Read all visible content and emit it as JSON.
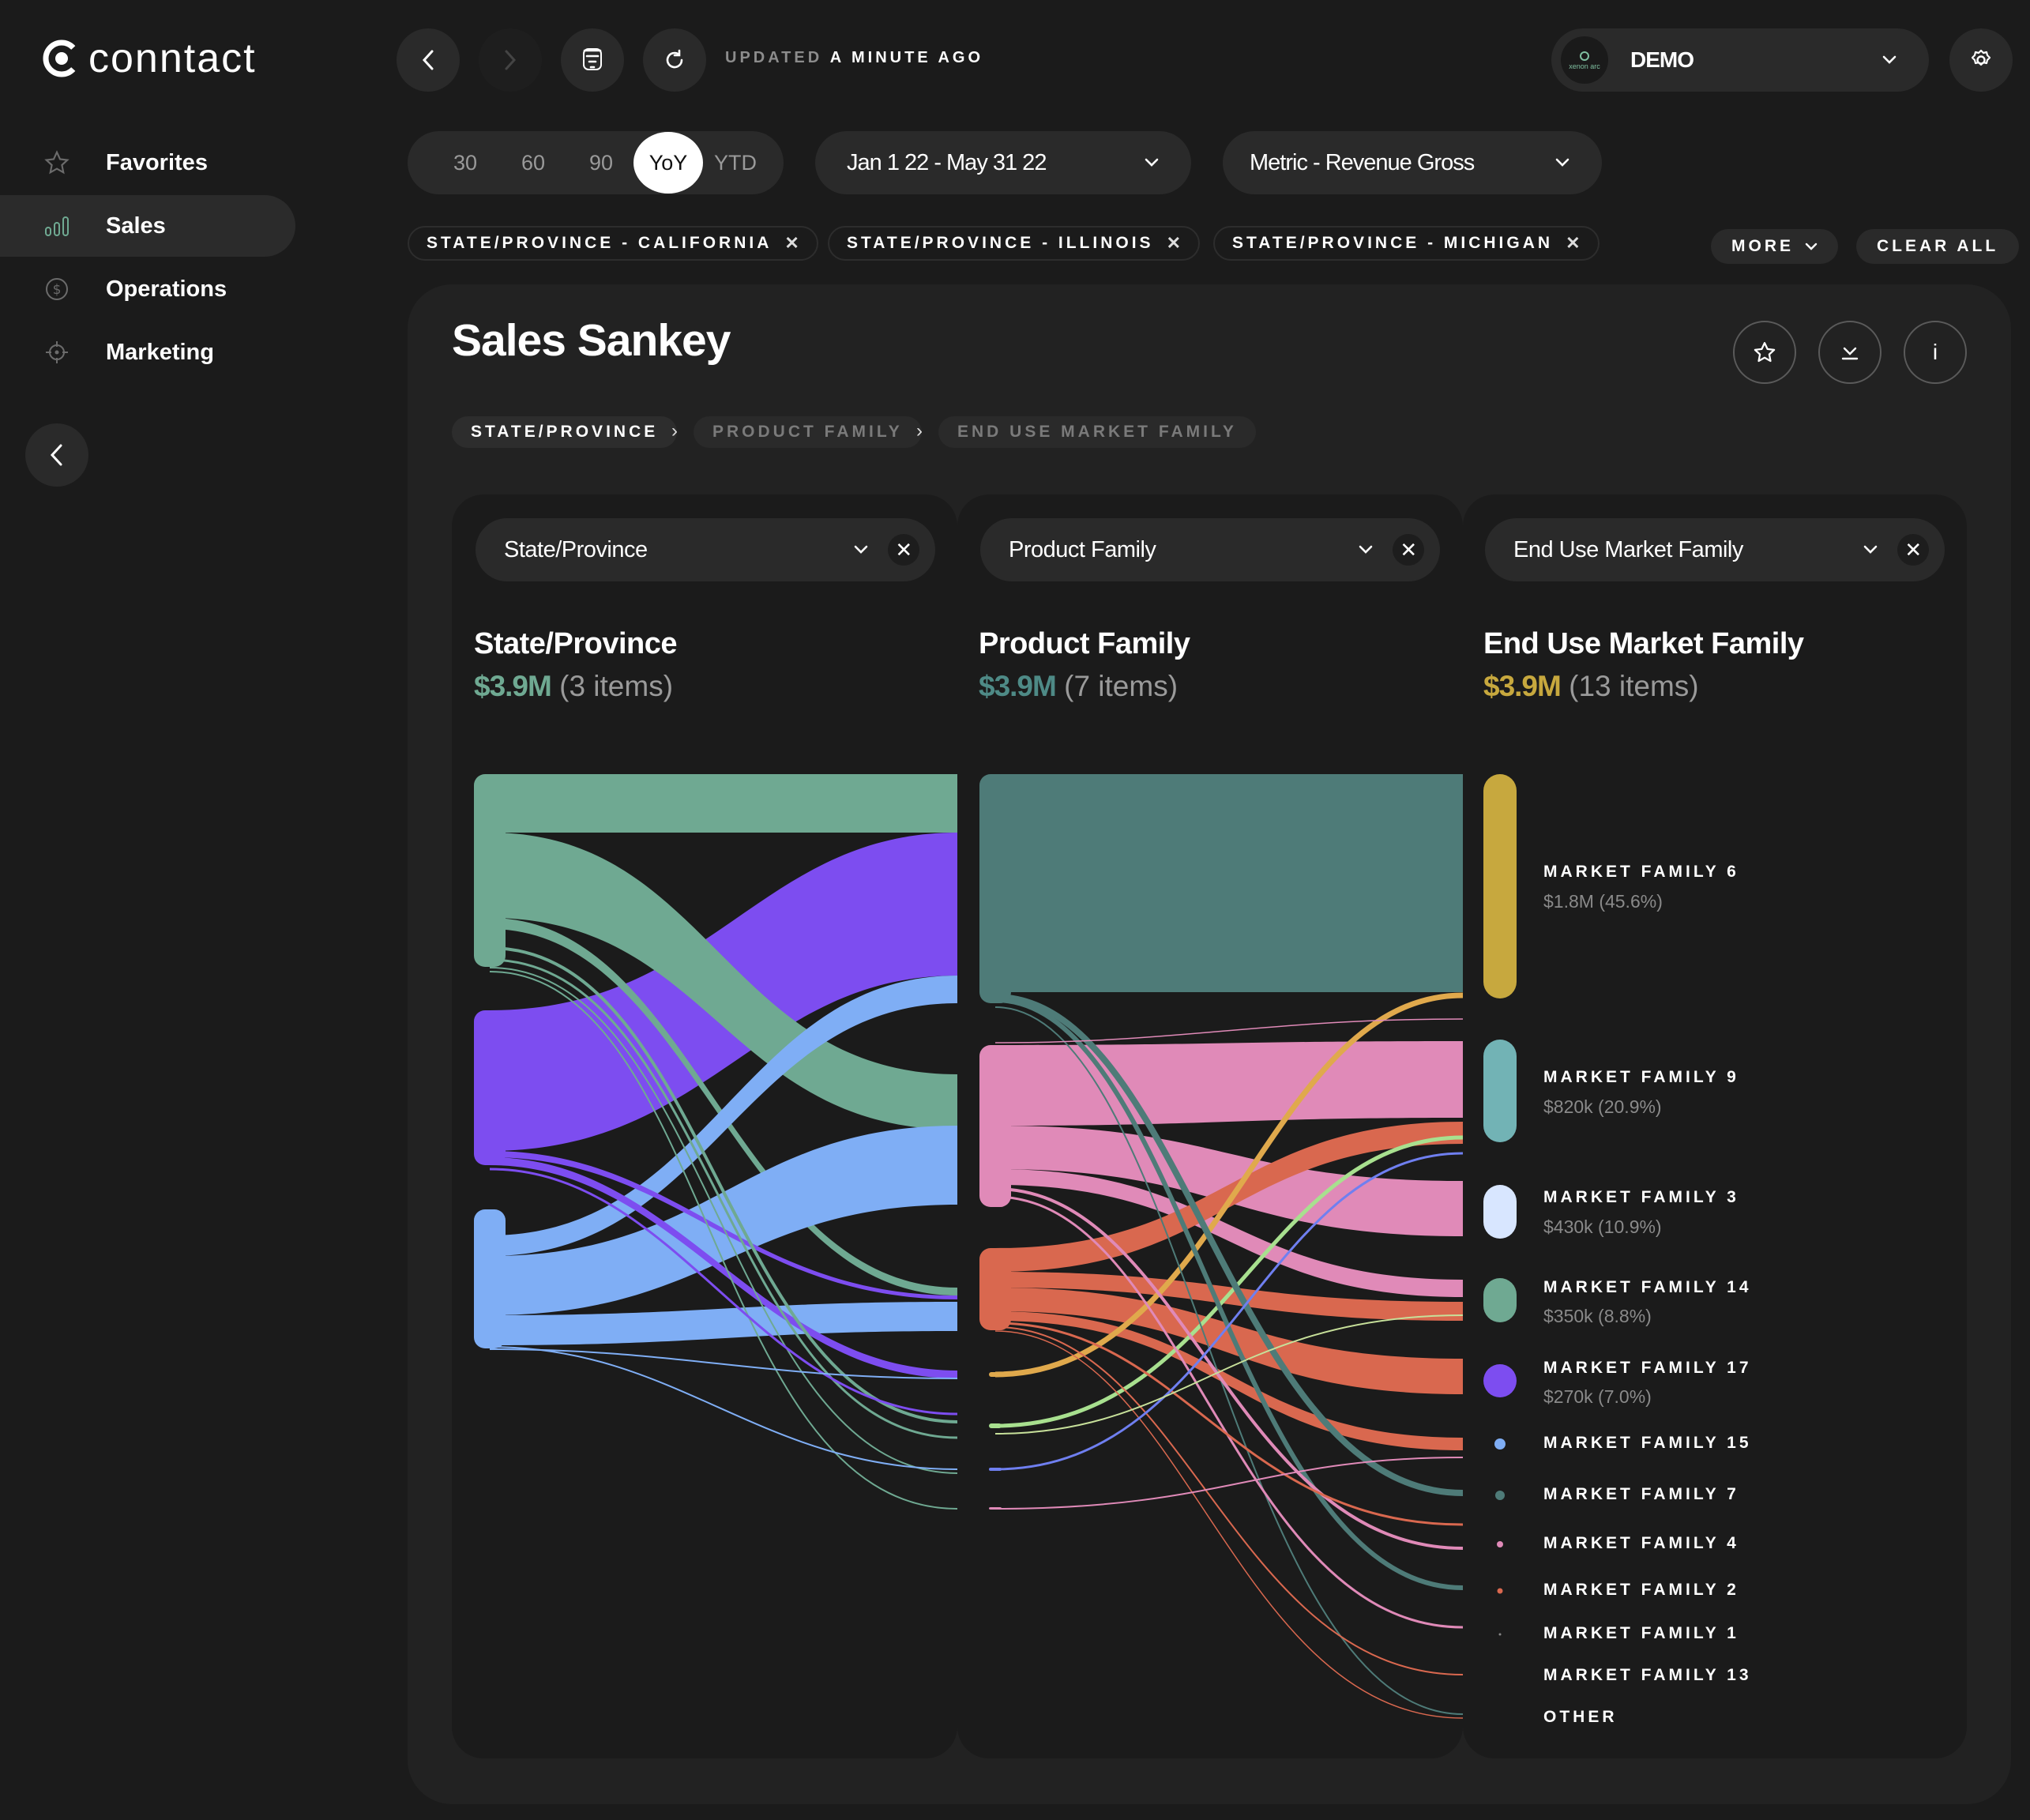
{
  "app": {
    "name": "conntact"
  },
  "sidebar": {
    "items": [
      {
        "label": "Favorites",
        "icon": "star-icon"
      },
      {
        "label": "Sales",
        "icon": "bar-chart-icon",
        "active": true
      },
      {
        "label": "Operations",
        "icon": "dollar-icon"
      },
      {
        "label": "Marketing",
        "icon": "target-icon"
      }
    ]
  },
  "topbar": {
    "updated_prefix": "UPDATED",
    "updated_time": "A MINUTE AGO",
    "workspace": {
      "avatar_text": "xenon arc",
      "name": "DEMO"
    }
  },
  "filters": {
    "periods": [
      "30",
      "60",
      "90",
      "YoY",
      "YTD"
    ],
    "selected_period": "YoY",
    "date_range": "Jan 1 22 - May 31 22",
    "metric": "Metric - Revenue Gross",
    "chips": [
      "STATE/PROVINCE - CALIFORNIA",
      "STATE/PROVINCE - ILLINOIS",
      "STATE/PROVINCE - MICHIGAN"
    ],
    "more_label": "MORE",
    "clear_label": "CLEAR ALL"
  },
  "card": {
    "title": "Sales Sankey",
    "breadcrumbs": [
      "STATE/PROVINCE",
      "PRODUCT FAMILY",
      "END USE MARKET FAMILY"
    ],
    "card_info_label": "i"
  },
  "columns": [
    {
      "dropdown": "State/Province",
      "title": "State/Province",
      "total": "$3.9M",
      "count": "(3 items)",
      "color": "#6fa992"
    },
    {
      "dropdown": "Product Family",
      "title": "Product Family",
      "total": "$3.9M",
      "count": "(7 items)",
      "color": "#4e7b78"
    },
    {
      "dropdown": "End Use Market Family",
      "title": "End Use Market Family",
      "total": "$3.9M",
      "count": "(13 items)",
      "color": "#c7a83e"
    }
  ],
  "legend": [
    {
      "label": "MARKET FAMILY 6",
      "value": "$1.8M (45.6%)",
      "color": "#c7a83e"
    },
    {
      "label": "MARKET FAMILY 9",
      "value": "$820k (20.9%)",
      "color": "#72b3b5"
    },
    {
      "label": "MARKET FAMILY 3",
      "value": "$430k (10.9%)",
      "color": "#d8e6ff"
    },
    {
      "label": "MARKET FAMILY 14",
      "value": "$350k (8.8%)",
      "color": "#6fa992"
    },
    {
      "label": "MARKET FAMILY 17",
      "value": "$270k (7.0%)",
      "color": "#7d4df0"
    },
    {
      "label": "MARKET FAMILY 15",
      "value": "",
      "color": "#7faef5"
    },
    {
      "label": "MARKET FAMILY 7",
      "value": "",
      "color": "#4e7b78"
    },
    {
      "label": "MARKET FAMILY 4",
      "value": "",
      "color": "#e08ab8"
    },
    {
      "label": "MARKET FAMILY 2",
      "value": "",
      "color": "#d9684f"
    },
    {
      "label": "MARKET FAMILY 1",
      "value": "",
      "color": "#888888"
    },
    {
      "label": "MARKET FAMILY 13",
      "value": "",
      "color": "#888888"
    },
    {
      "label": "OTHER",
      "value": "",
      "color": "#888888"
    }
  ]
}
